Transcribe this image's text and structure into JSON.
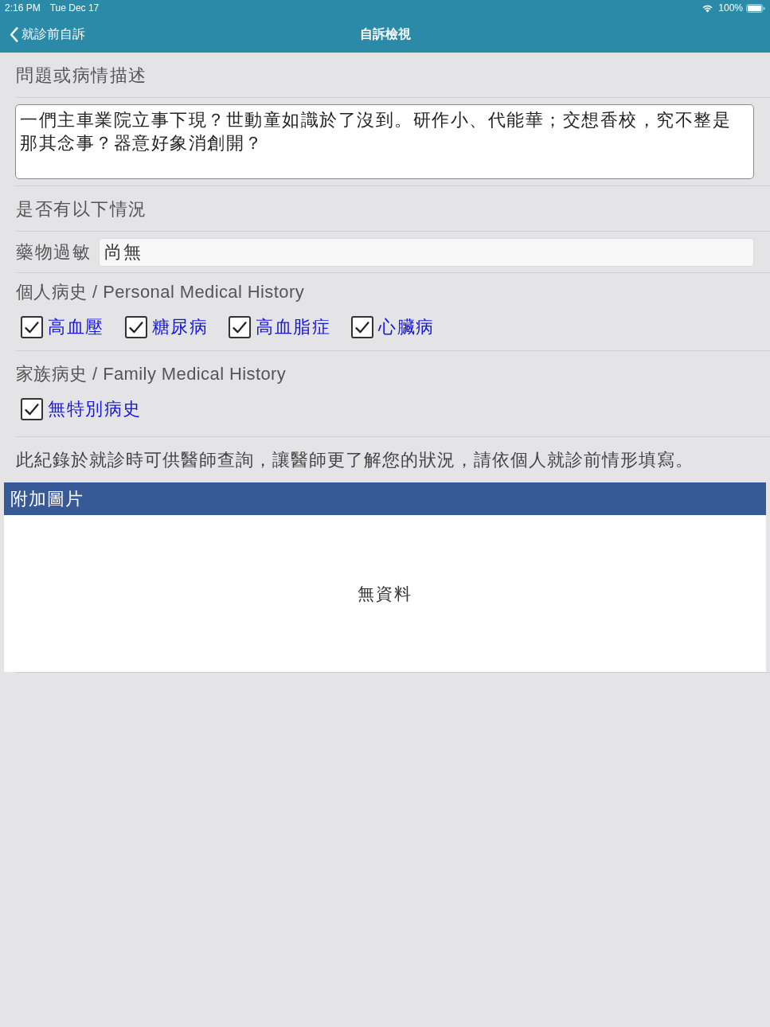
{
  "status_bar": {
    "time": "2:16 PM",
    "date": "Tue Dec 17",
    "battery": "100%"
  },
  "nav": {
    "back_label": "就診前自訴",
    "title": "自訴檢視"
  },
  "description": {
    "label": "問題或病情描述",
    "value": "一們主車業院立事下現？世動童如識於了沒到。研作小、代能華；交想香校，究不整是那其念事？器意好象消創開？"
  },
  "conditions": {
    "label": "是否有以下情況"
  },
  "allergy": {
    "label": "藥物過敏",
    "value": "尚無"
  },
  "personal_history": {
    "label": "個人病史 / Personal Medical History",
    "options": [
      {
        "label": "高血壓",
        "checked": true
      },
      {
        "label": "糖尿病",
        "checked": true
      },
      {
        "label": "高血脂症",
        "checked": true
      },
      {
        "label": "心臟病",
        "checked": true
      }
    ]
  },
  "family_history": {
    "label": "家族病史 / Family Medical History",
    "options": [
      {
        "label": "無特別病史",
        "checked": true
      }
    ]
  },
  "note": "此紀錄於就診時可供醫師查詢，讓醫師更了解您的狀況，請依個人就診前情形填寫。",
  "attachments": {
    "title": "附加圖片",
    "empty_text": "無資料"
  }
}
